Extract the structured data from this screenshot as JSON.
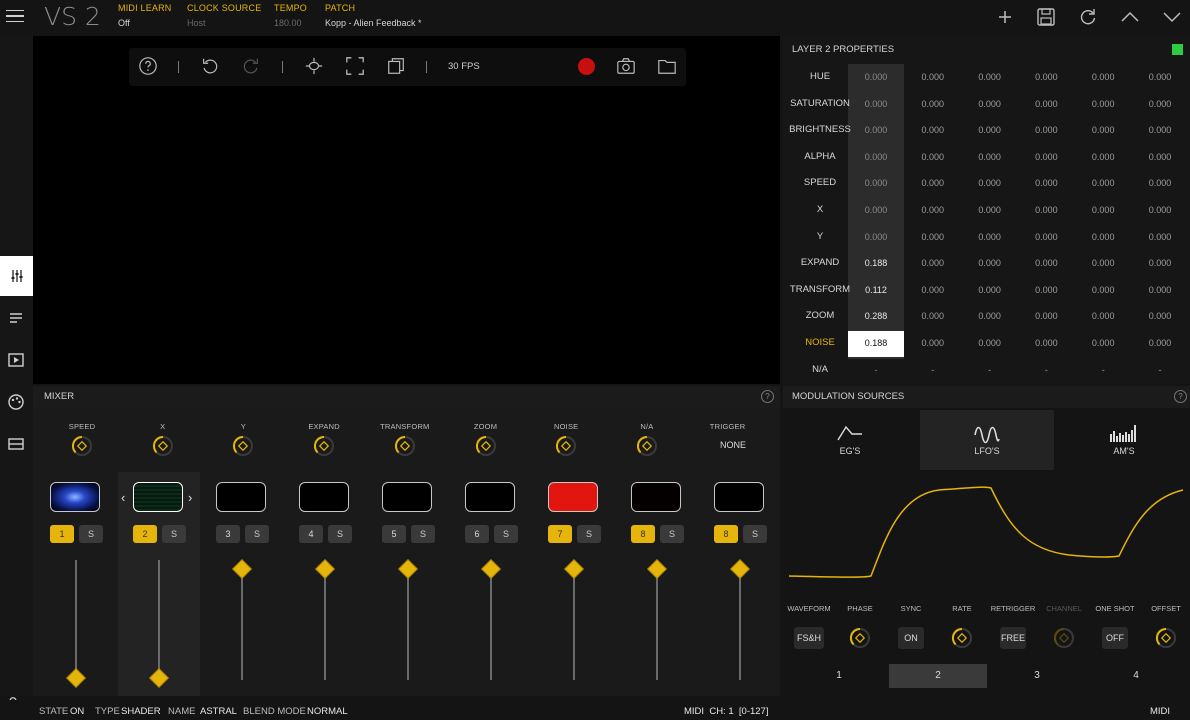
{
  "app": {
    "logo": "VS 2"
  },
  "topbar": {
    "midi_learn": {
      "label": "MIDI LEARN",
      "value": "Off"
    },
    "clock_source": {
      "label": "CLOCK SOURCE",
      "value": "Host"
    },
    "tempo": {
      "label": "TEMPO",
      "value": "180.00"
    },
    "patch": {
      "label": "PATCH",
      "value": "Kopp - Alien Feedback *"
    },
    "icons": [
      "plus-icon",
      "save-icon",
      "reload-icon",
      "chevron-up-icon",
      "chevron-down-icon"
    ]
  },
  "sidebar": {
    "icons": [
      "sliders-icon",
      "list-icon",
      "play-icon",
      "palette-icon",
      "storage-icon",
      "lock-icon"
    ]
  },
  "preview_toolbar": {
    "fps": "30 FPS",
    "record_color": "#c80f0f"
  },
  "properties": {
    "title": "LAYER 2 PROPERTIES",
    "rows": [
      {
        "label": "HUE",
        "values": [
          "0.000",
          "0.000",
          "0.000",
          "0.000",
          "0.000",
          "0.000"
        ]
      },
      {
        "label": "SATURATION",
        "values": [
          "0.000",
          "0.000",
          "0.000",
          "0.000",
          "0.000",
          "0.000"
        ]
      },
      {
        "label": "BRIGHTNESS",
        "values": [
          "0.000",
          "0.000",
          "0.000",
          "0.000",
          "0.000",
          "0.000"
        ]
      },
      {
        "label": "ALPHA",
        "values": [
          "0.000",
          "0.000",
          "0.000",
          "0.000",
          "0.000",
          "0.000"
        ]
      },
      {
        "label": "SPEED",
        "values": [
          "0.000",
          "0.000",
          "0.000",
          "0.000",
          "0.000",
          "0.000"
        ]
      },
      {
        "label": "X",
        "values": [
          "0.000",
          "0.000",
          "0.000",
          "0.000",
          "0.000",
          "0.000"
        ]
      },
      {
        "label": "Y",
        "values": [
          "0.000",
          "0.000",
          "0.000",
          "0.000",
          "0.000",
          "0.000"
        ]
      },
      {
        "label": "EXPAND",
        "values": [
          "0.188",
          "0.000",
          "0.000",
          "0.000",
          "0.000",
          "0.000"
        ]
      },
      {
        "label": "TRANSFORM",
        "values": [
          "0.112",
          "0.000",
          "0.000",
          "0.000",
          "0.000",
          "0.000"
        ]
      },
      {
        "label": "ZOOM",
        "values": [
          "0.288",
          "0.000",
          "0.000",
          "0.000",
          "0.000",
          "0.000"
        ]
      },
      {
        "label": "NOISE",
        "values": [
          "0.188",
          "0.000",
          "0.000",
          "0.000",
          "0.000",
          "0.000"
        ]
      },
      {
        "label": "N/A",
        "values": [
          "-",
          "-",
          "-",
          "-",
          "-",
          "-"
        ]
      }
    ]
  },
  "mixer": {
    "title": "MIXER",
    "params": [
      "SPEED",
      "X",
      "Y",
      "EXPAND",
      "TRANSFORM",
      "ZOOM",
      "NOISE",
      "N/A",
      "TRIGGER"
    ],
    "trigger_value": "NONE",
    "channels": [
      {
        "num": "1",
        "solo": "S",
        "active": true,
        "level": 0.0
      },
      {
        "num": "2",
        "solo": "S",
        "active": true,
        "level": 0.0
      },
      {
        "num": "3",
        "solo": "S",
        "active": false,
        "level": 0.92
      },
      {
        "num": "4",
        "solo": "S",
        "active": false,
        "level": 0.92
      },
      {
        "num": "5",
        "solo": "S",
        "active": false,
        "level": 0.92
      },
      {
        "num": "6",
        "solo": "S",
        "active": false,
        "level": 0.92
      },
      {
        "num": "7",
        "solo": "S",
        "active": true,
        "level": 0.92
      },
      {
        "num": "8",
        "solo": "S",
        "active": true,
        "level": 0.92
      },
      {
        "num": "8",
        "solo": "S",
        "active": true,
        "level": 0.92
      }
    ]
  },
  "modulation": {
    "title": "MODULATION SOURCES",
    "tabs": [
      "EG'S",
      "LFO'S",
      "AM'S"
    ],
    "controls": [
      {
        "label": "WAVEFORM",
        "value": "FS&H"
      },
      {
        "label": "PHASE",
        "value": ""
      },
      {
        "label": "SYNC",
        "value": "ON"
      },
      {
        "label": "RATE",
        "value": ""
      },
      {
        "label": "RETRIGGER",
        "value": "FREE"
      },
      {
        "label": "CHANNEL",
        "value": ""
      },
      {
        "label": "ONE SHOT",
        "value": "OFF"
      },
      {
        "label": "OFFSET",
        "value": ""
      }
    ],
    "pages": [
      "1",
      "2",
      "3",
      "4"
    ]
  },
  "status": {
    "state_k": "STATE",
    "state_v": "ON",
    "type_k": "TYPE",
    "type_v": "SHADER",
    "name_k": "NAME",
    "name_v": "ASTRAL",
    "blend_k": "BLEND MODE",
    "blend_v": "NORMAL",
    "midi_ch": "MIDI  CH: 1  [0-127]",
    "midi": "MIDI"
  },
  "colors": {
    "accent": "#e5b50c",
    "led": "#2ecc40",
    "record": "#c80f0f"
  }
}
